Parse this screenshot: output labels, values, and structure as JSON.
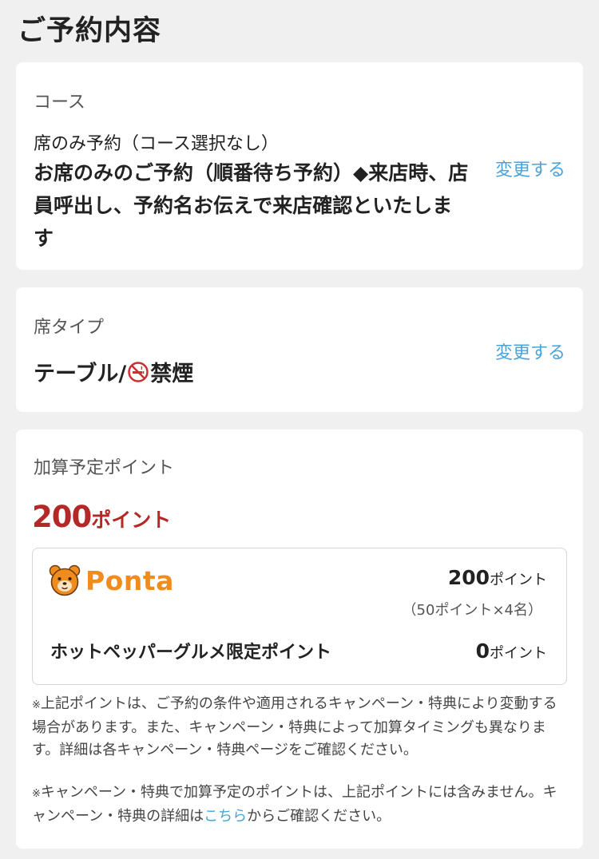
{
  "page_title": "ご予約内容",
  "course": {
    "label": "コース",
    "sub": "席のみ予約（コース選択なし）",
    "main": "お席のみのご予約（順番待ち予約）◆来店時、店員呼出し、予約名お伝えで来店確認といたします",
    "change_label": "変更する"
  },
  "seat": {
    "label": "席タイプ",
    "value_prefix": "テーブル/",
    "value_suffix": "禁煙",
    "icon": "no-smoking-icon",
    "change_label": "変更する"
  },
  "points": {
    "label": "加算予定ポイント",
    "total_num": "200",
    "total_unit": "ポイント",
    "ponta": {
      "brand": "Ponta",
      "value": "200",
      "unit": "ポイント",
      "breakdown": "（50ポイント×4名）"
    },
    "hotpepper": {
      "label": "ホットペッパーグルメ限定ポイント",
      "value": "0",
      "unit": "ポイント"
    }
  },
  "notes": {
    "mark": "※",
    "note1": "上記ポイントは、ご予約の条件や適用されるキャンペーン・特典により変動する場合があります。また、キャンペーン・特典によって加算タイミングも異なります。詳細は各キャンペーン・特典ページをご確認ください。",
    "note2_pre": "キャンペーン・特典で加算予定のポイントは、上記ポイントには含みません。キャンペーン・特典の詳細は",
    "note2_link": "こちら",
    "note2_post": "からご確認ください。"
  },
  "colors": {
    "accent_link": "#4aa3d8",
    "points_red": "#b52828",
    "ponta_orange": "#f08c1e"
  }
}
